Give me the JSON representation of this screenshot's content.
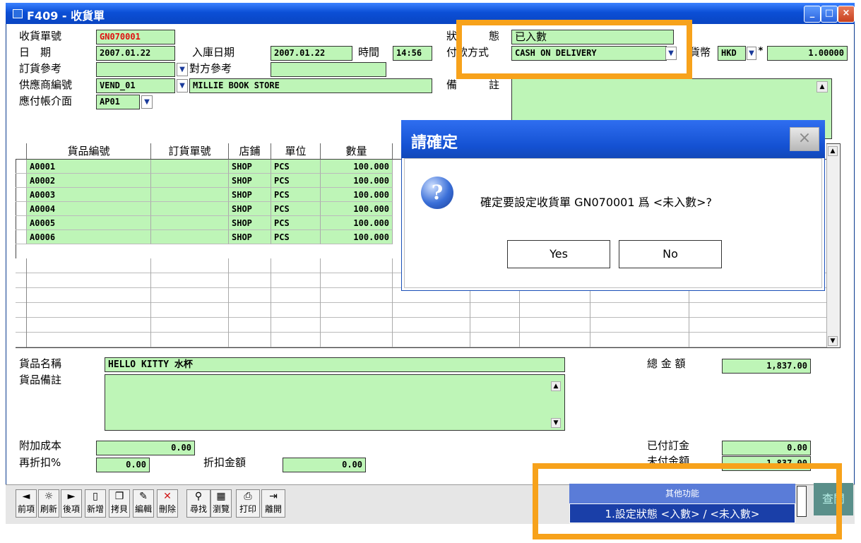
{
  "window": {
    "title": "F409 - 收貨單"
  },
  "header": {
    "receipt_no_label": "收貨單號",
    "receipt_no": "GN070001",
    "date_label": "日　期",
    "date": "2007.01.22",
    "in_date_label": "入庫日期",
    "in_date": "2007.01.22",
    "time_label": "時間",
    "time": "14:56",
    "order_ref_label": "訂貨參考",
    "order_ref": "",
    "counter_ref_label": "對方參考",
    "counter_ref": "",
    "vendor_no_label": "供應商編號",
    "vendor_no": "VEND_01",
    "vendor_name": "MILLIE BOOK STORE",
    "ap_label": "應付帳介面",
    "ap": "AP01",
    "status_label_left": "狀",
    "status_label_right": "態",
    "status": "已入數",
    "payment_label": "付款方式",
    "payment": "CASH ON DELIVERY",
    "currency_label": "貨幣",
    "currency": "HKD",
    "rate_mark": "*",
    "rate": "1.00000",
    "remark_label_left": "備",
    "remark_label_right": "註"
  },
  "grid": {
    "columns": [
      "貨品編號",
      "訂貨單號",
      "店鋪",
      "單位",
      "數量"
    ],
    "rows": [
      {
        "item": "A0001",
        "order": "",
        "shop": "SHOP",
        "unit": "PCS",
        "qty": "100.000"
      },
      {
        "item": "A0002",
        "order": "",
        "shop": "SHOP",
        "unit": "PCS",
        "qty": "100.000"
      },
      {
        "item": "A0003",
        "order": "",
        "shop": "SHOP",
        "unit": "PCS",
        "qty": "100.000"
      },
      {
        "item": "A0004",
        "order": "",
        "shop": "SHOP",
        "unit": "PCS",
        "qty": "100.000"
      },
      {
        "item": "A0005",
        "order": "",
        "shop": "SHOP",
        "unit": "PCS",
        "qty": "100.000"
      },
      {
        "item": "A0006",
        "order": "",
        "shop": "SHOP",
        "unit": "PCS",
        "qty": "100.000"
      }
    ]
  },
  "detail": {
    "item_name_label": "貨品名稱",
    "item_name": "HELLO KITTY 水杯",
    "item_remark_label": "貨品備註",
    "total_label": "總 金 額",
    "total": "1,837.00",
    "extra_cost_label": "附加成本",
    "extra_cost": "0.00",
    "rediscount_label": "再折扣%",
    "rediscount": "0.00",
    "discount_amt_label": "折扣金額",
    "discount_amt": "0.00",
    "paid_deposit_label": "已付訂金",
    "paid_deposit": "0.00",
    "unpaid_label": "未付金額",
    "unpaid": "1,837.00"
  },
  "toolbar": [
    {
      "label": "前項",
      "icon": "prev-icon"
    },
    {
      "label": "刷新",
      "icon": "refresh-icon"
    },
    {
      "label": "後項",
      "icon": "next-icon"
    },
    {
      "label": "新增",
      "icon": "new-icon"
    },
    {
      "label": "拷貝",
      "icon": "copy-icon"
    },
    {
      "label": "編輯",
      "icon": "edit-icon"
    },
    {
      "label": "刪除",
      "icon": "delete-icon"
    },
    {
      "label": "尋找",
      "icon": "find-icon"
    },
    {
      "label": "瀏覽",
      "icon": "browse-icon"
    },
    {
      "label": "打印",
      "icon": "print-icon"
    },
    {
      "label": "離開",
      "icon": "exit-icon"
    }
  ],
  "popup_menu": {
    "header": "其他功能",
    "item": "1.設定狀態 <入數> / <未入數>",
    "side_button": "查閱"
  },
  "dialog": {
    "title": "請確定",
    "message": "確定要設定收貨單 GN070001 爲 <未入數>?",
    "yes": "Yes",
    "no": "No"
  },
  "colors": {
    "field_bg": "#bef5b7",
    "highlight": "#f7a21b",
    "title_blue": "#0b4fd6"
  }
}
